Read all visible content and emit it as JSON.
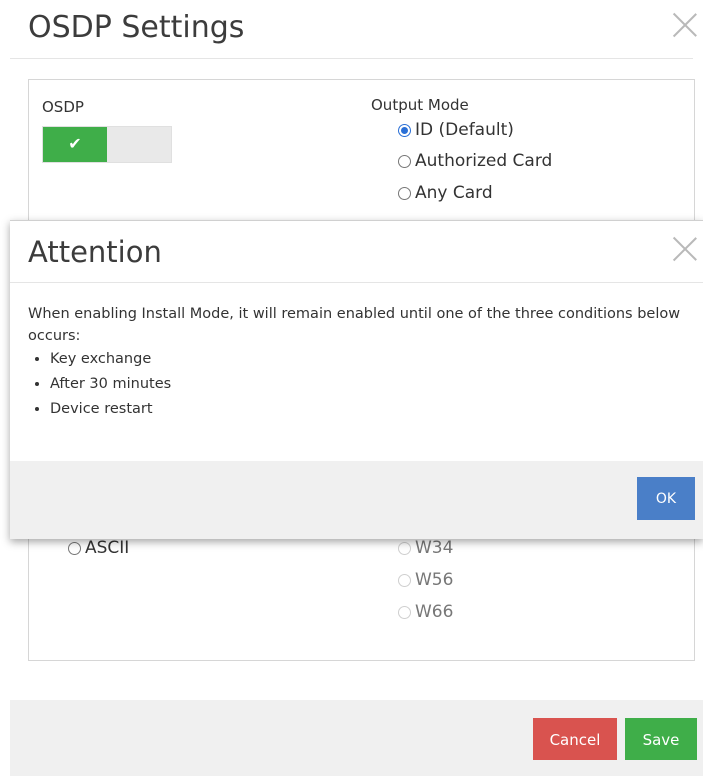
{
  "osdp_settings": {
    "title": "OSDP Settings",
    "osdp_label": "OSDP",
    "osdp_toggle_checkmark": "✔",
    "output_mode_label": "Output Mode",
    "output_modes": [
      {
        "label": "ID (Default)",
        "checked": true
      },
      {
        "label": "Authorized Card",
        "checked": false
      },
      {
        "label": "Any Card",
        "checked": false
      }
    ],
    "left_options": [
      {
        "label": "ASCII",
        "checked": false
      }
    ],
    "right_options": [
      {
        "label": "W34",
        "disabled": true
      },
      {
        "label": "W56",
        "disabled": true
      },
      {
        "label": "W66",
        "disabled": true
      }
    ],
    "cancel_label": "Cancel",
    "save_label": "Save"
  },
  "attention": {
    "title": "Attention",
    "message": "When enabling Install Mode, it will remain enabled until one of the three conditions below occurs:",
    "conditions": [
      "Key exchange",
      "After 30 minutes",
      "Device restart"
    ],
    "ok_label": "OK"
  },
  "colors": {
    "green": "#3fae49",
    "red": "#d9534f",
    "blue": "#4a7fc8"
  }
}
